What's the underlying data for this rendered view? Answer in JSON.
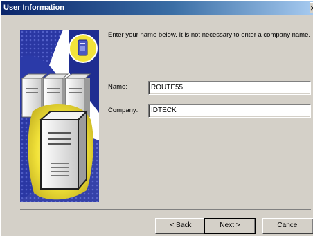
{
  "window": {
    "title": "User Information"
  },
  "content": {
    "intro_text": "Enter your name below.  It is not necessary to enter a company name."
  },
  "fields": {
    "name": {
      "label": "Name:",
      "value": "ROUTE55"
    },
    "company": {
      "label": "Company:",
      "value": "IDTECK"
    }
  },
  "buttons": {
    "back": "< Back",
    "next": "Next >",
    "cancel": "Cancel"
  },
  "colors": {
    "title_bar": "#0a246a",
    "dialog_face": "#d4d0c8",
    "art_blue": "#2b3aa8",
    "art_glow": "#f2e33a"
  },
  "icons": {
    "art": "server-computers-illustration",
    "badge": "computer-tower-icon",
    "close": "close-icon"
  }
}
